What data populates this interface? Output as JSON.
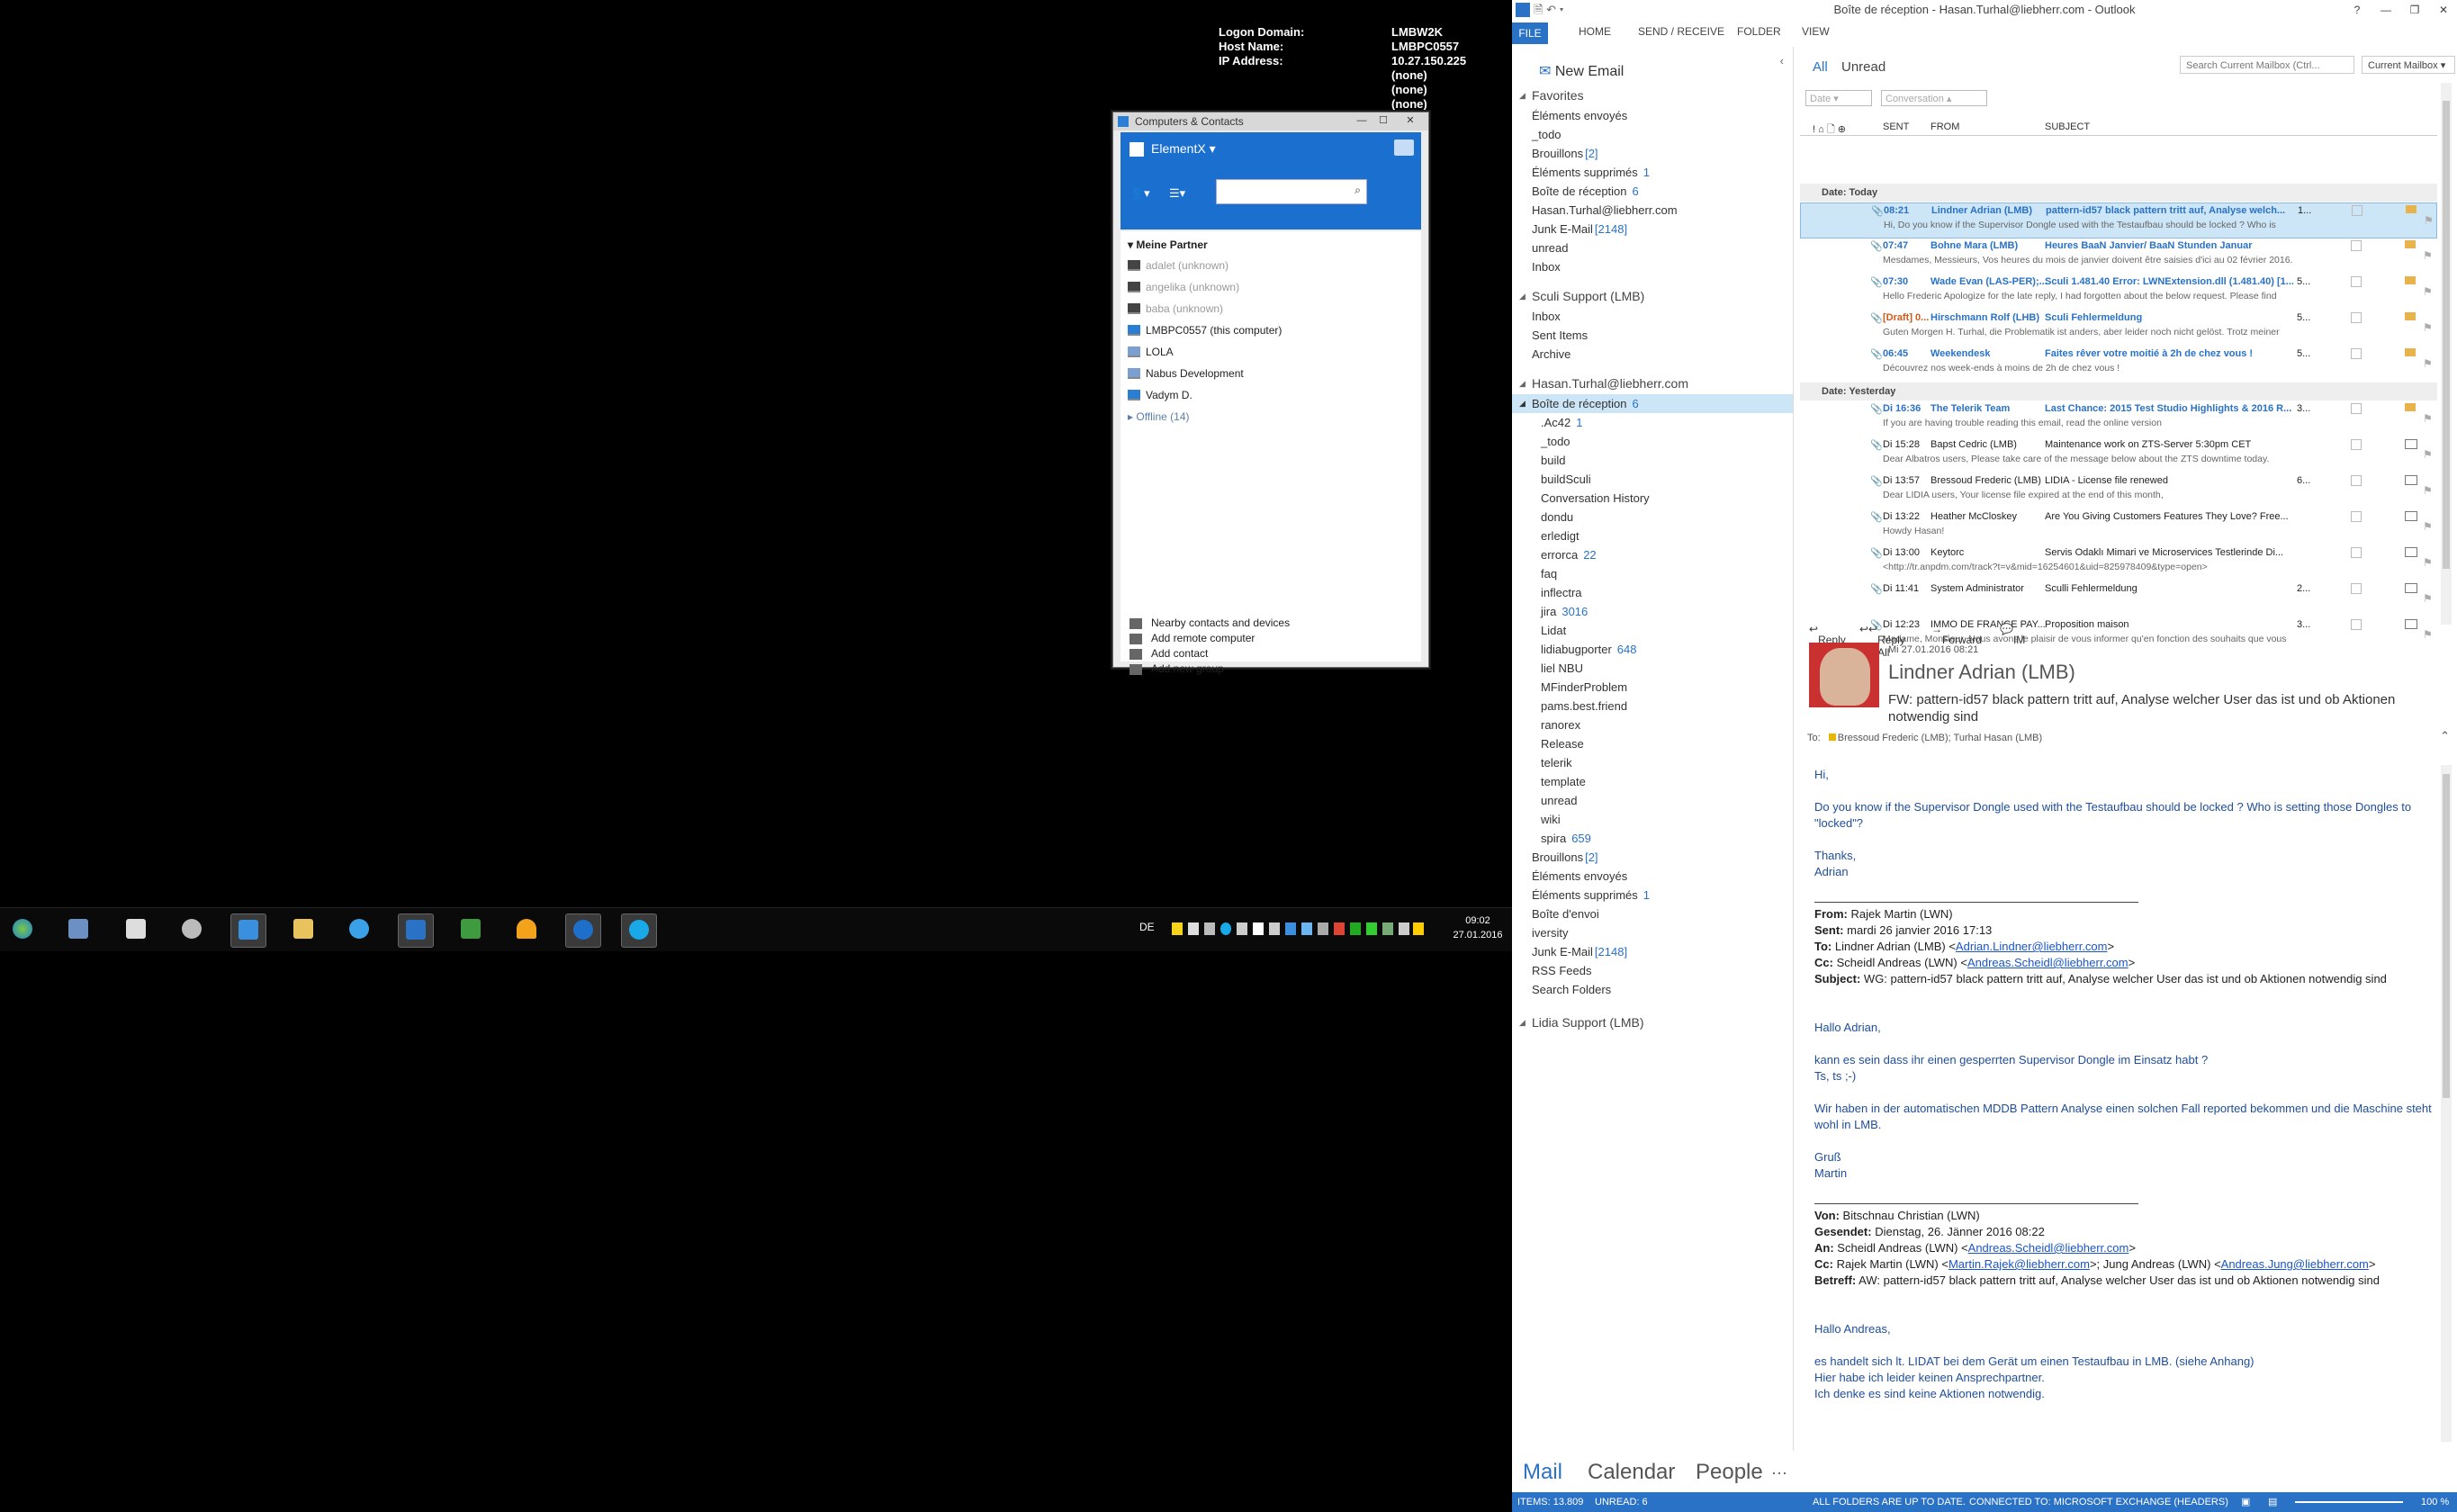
{
  "bginfo": {
    "rows": [
      {
        "k": "Logon Domain:",
        "v": "LMBW2K"
      },
      {
        "k": "Host Name:",
        "v": "LMBPC0557"
      },
      {
        "k": "IP Address:",
        "v": "10.27.150.225"
      },
      {
        "k": "",
        "v": "(none)"
      },
      {
        "k": "",
        "v": "(none)"
      },
      {
        "k": "",
        "v": "(none)"
      },
      {
        "k": "",
        "v": "(none)"
      }
    ]
  },
  "teamviewer": {
    "title": "Computers & Contacts",
    "account": "ElementX ▾",
    "search_placeholder": "",
    "group": "Meine Partner",
    "items": [
      {
        "label": "adalet (unknown)",
        "offline": true
      },
      {
        "label": "angelika (unknown)",
        "offline": true
      },
      {
        "label": "baba (unknown)",
        "offline": true
      },
      {
        "label": "LMBPC0557 (this computer)",
        "offline": false
      },
      {
        "label": "LOLA",
        "offline": false
      },
      {
        "label": "Nabus Development",
        "offline": false
      },
      {
        "label": "Vadym D.",
        "offline": false
      }
    ],
    "offline_group": "Offline (14)",
    "actions": [
      "Nearby contacts and devices",
      "Add remote computer",
      "Add contact",
      "Add new group"
    ]
  },
  "taskbar": {
    "lang": "DE",
    "time": "09:02",
    "date": "27.01.2016"
  },
  "outlook": {
    "window_title": "Boîte de réception - Hasan.Turhal@liebherr.com - Outlook",
    "ribbon": [
      "FILE",
      "HOME",
      "SEND / RECEIVE",
      "FOLDER",
      "VIEW"
    ],
    "new_email": "New Email",
    "favorites": {
      "title": "Favorites",
      "items": [
        {
          "label": "Éléments envoyés",
          "count": ""
        },
        {
          "label": "_todo",
          "count": ""
        },
        {
          "label": "Brouillons",
          "count": "[2]"
        },
        {
          "label": "Éléments supprimés",
          "count": "1"
        },
        {
          "label": "Boîte de réception",
          "count": "6"
        },
        {
          "label": "Hasan.Turhal@liebherr.com",
          "count": ""
        },
        {
          "label": "Junk E-Mail",
          "count": "[2148]"
        },
        {
          "label": "unread",
          "count": ""
        },
        {
          "label": "Inbox",
          "count": ""
        }
      ]
    },
    "sculi": {
      "title": "Sculi Support (LMB)",
      "items": [
        "Inbox",
        "Sent Items",
        "Archive"
      ]
    },
    "account": {
      "title": "Hasan.Turhal@liebherr.com",
      "inbox": {
        "label": "Boîte de réception",
        "count": "6"
      },
      "sub": [
        {
          "label": ".Ac42",
          "count": "1"
        },
        {
          "label": "_todo",
          "count": ""
        },
        {
          "label": "build",
          "count": ""
        },
        {
          "label": "buildSculi",
          "count": ""
        },
        {
          "label": "Conversation History",
          "count": ""
        },
        {
          "label": "dondu",
          "count": ""
        },
        {
          "label": "erledigt",
          "count": ""
        },
        {
          "label": "errorca",
          "count": "22"
        },
        {
          "label": "faq",
          "count": ""
        },
        {
          "label": "inflectra",
          "count": ""
        },
        {
          "label": "jira",
          "count": "3016"
        },
        {
          "label": "Lidat",
          "count": ""
        },
        {
          "label": "lidiabugporter",
          "count": "648"
        },
        {
          "label": "liel NBU",
          "count": ""
        },
        {
          "label": "MFinderProblem",
          "count": ""
        },
        {
          "label": "pams.best.friend",
          "count": ""
        },
        {
          "label": "ranorex",
          "count": ""
        },
        {
          "label": "Release",
          "count": ""
        },
        {
          "label": "telerik",
          "count": ""
        },
        {
          "label": "template",
          "count": ""
        },
        {
          "label": "unread",
          "count": ""
        },
        {
          "label": "wiki",
          "count": ""
        },
        {
          "label": "spira",
          "count": "659"
        }
      ],
      "rest": [
        {
          "label": "Brouillons",
          "count": "[2]"
        },
        {
          "label": "Éléments envoyés",
          "count": ""
        },
        {
          "label": "Éléments supprimés",
          "count": "1"
        },
        {
          "label": "Boîte d'envoi",
          "count": ""
        },
        {
          "label": "iversity",
          "count": ""
        },
        {
          "label": "Junk E-Mail",
          "count": "[2148]"
        },
        {
          "label": "RSS Feeds",
          "count": ""
        },
        {
          "label": "Search Folders",
          "count": ""
        }
      ]
    },
    "lidia": "Lidia Support (LMB)",
    "bottomnav": [
      "Mail",
      "Calendar",
      "People",
      "···"
    ],
    "status": {
      "items": "ITEMS: 13.809",
      "unread": "UNREAD: 6",
      "sync": "ALL FOLDERS ARE UP TO DATE.",
      "conn": "CONNECTED TO: MICROSOFT EXCHANGE (HEADERS)",
      "zoom": "100 %"
    },
    "list": {
      "filter_all": "All",
      "filter_unread": "Unread",
      "search_placeholder": "Search Current Mailbox (Ctrl...",
      "scope": "Current Mailbox ▾",
      "sort_date": "Date",
      "sort_conv": "Conversation",
      "headers": {
        "sent": "SENT",
        "from": "FROM",
        "subject": "SUBJECT"
      },
      "today": "Date: Today",
      "yesterday": "Date: Yesterday",
      "today_msgs": [
        {
          "time": "08:21",
          "from": "Lindner Adrian (LMB)",
          "subject": "pattern-id57 black pattern tritt auf, Analyse welch...",
          "preview": "Hi,  Do you know if the Supervisor Dongle used with the Testaufbau should be locked ? Who is",
          "size": "1...",
          "unread": true,
          "sel": true
        },
        {
          "time": "07:47",
          "from": "Bohne Mara (LMB)",
          "subject": "Heures BaaN Janvier/ BaaN Stunden Januar",
          "preview": "Mesdames, Messieurs,  Vos heures du mois de janvier doivent être saisies d'ici au 02 février 2016.",
          "size": "",
          "unread": true,
          "sel": false
        },
        {
          "time": "07:30",
          "from": "Wade Evan (LAS-PER);...",
          "subject": "Sculi 1.481.40 Error: LWNExtension.dll (1.481.40) [1...",
          "preview": "Hello Frederic  Apologize for the late reply, I had forgotten about the below request.  Please find",
          "size": "5...",
          "unread": true,
          "sel": false
        },
        {
          "time": "[Draft] 0...",
          "from": "Hirschmann Rolf (LHB)",
          "subject": "Sculi Fehlermeldung",
          "preview": "Guten Morgen H. Turhal,  die Problematik ist anders, aber leider noch nicht gelöst. Trotz meiner",
          "size": "5...",
          "unread": true,
          "sel": false
        },
        {
          "time": "06:45",
          "from": "Weekendesk",
          "subject": "Faites rêver votre moitié à 2h de chez vous !",
          "preview": "Découvrez nos week-ends à moins de 2h de chez vous !",
          "size": "5...",
          "unread": true,
          "sel": false
        }
      ],
      "yest_msgs": [
        {
          "time": "Di 16:36",
          "from": "The Telerik Team",
          "subject": "Last Chance: 2015 Test Studio Highlights & 2016 R...",
          "preview": "If you are having trouble reading this email, read the online version",
          "size": "3...",
          "unread": true
        },
        {
          "time": "Di 15:28",
          "from": "Bapst Cedric (LMB)",
          "subject": "Maintenance work on ZTS-Server 5:30pm CET",
          "preview": "Dear Albatros users,  Please take care of the message below about the ZTS downtime today.",
          "size": "",
          "unread": false
        },
        {
          "time": "Di 13:57",
          "from": "Bressoud Frederic (LMB)",
          "subject": "LIDIA - License file renewed",
          "preview": "Dear LIDIA users,  Your license file expired at the end of this month,",
          "size": "6...",
          "unread": false
        },
        {
          "time": "Di 13:22",
          "from": "Heather McCloskey",
          "subject": "Are You Giving Customers Features They Love? Free...",
          "preview": "Howdy Hasan!",
          "size": "",
          "unread": false
        },
        {
          "time": "Di 13:00",
          "from": "Keytorc",
          "subject": "Servis Odaklı Mimari ve Microservices Testlerinde Di...",
          "preview": "<http://tr.anpdm.com/track?t=v&mid=16254601&uid=825978409&type=open>",
          "size": "",
          "unread": false
        },
        {
          "time": "Di 11:41",
          "from": "System Administrator",
          "subject": "Sculli Fehlermeldung",
          "preview": "",
          "size": "2...",
          "unread": false
        },
        {
          "time": "Di 12:23",
          "from": "IMMO DE FRANCE PAY...",
          "subject": "Proposition maison",
          "preview": "Madame, Monsieur,  Nous avons le plaisir de vous informer qu'en fonction des souhaits que vous",
          "size": "3...",
          "unread": false
        }
      ]
    },
    "reading": {
      "actions": [
        "Reply",
        "Reply All",
        "Forward",
        "IM"
      ],
      "date": "Mi 27.01.2016 08:21",
      "from": "Lindner Adrian (LMB)",
      "subject": "FW: pattern-id57 black pattern tritt auf, Analyse welcher User das ist und ob Aktionen notwendig sind",
      "to_label": "To:",
      "to": "Bressoud Frederic (LMB);  Turhal Hasan (LMB)",
      "body": {
        "hi": "Hi,",
        "q1": "Do you know if the Supervisor Dongle used with the Testaufbau should be locked ? Who is setting those Dongles to \"locked\"?",
        "thanks": "Thanks,",
        "adrian": "Adrian",
        "from_k": "From:",
        "from_v": "Rajek Martin (LWN)",
        "sent_k": "Sent:",
        "sent_v": "mardi 26 janvier 2016 17:13",
        "to_k": "To:",
        "to_v": "Lindner Adrian (LMB) <",
        "to_link": "Adrian.Lindner@liebherr.com",
        "to_end": ">",
        "cc_k": "Cc:",
        "cc_v": "Scheidl Andreas (LWN) <",
        "cc_link": "Andreas.Scheidl@liebherr.com",
        "cc_end": ">",
        "subj_k": "Subject:",
        "subj_v": "WG: pattern-id57 black pattern tritt auf, Analyse welcher User das ist und ob Aktionen notwendig sind",
        "hallo_a": "Hallo Adrian,",
        "kann": "kann es sein dass ihr einen gesperrten Supervisor Dongle im Einsatz habt ?",
        "ts": "Ts, ts ;-)",
        "wir": "Wir haben in der automatischen MDDB Pattern Analyse einen solchen Fall reported bekommen und die Maschine steht wohl in LMB.",
        "gruss": "Gruß",
        "martin": "Martin",
        "von_k": "Von:",
        "von_v": "Bitschnau Christian (LWN)",
        "ges_k": "Gesendet:",
        "ges_v": "Dienstag, 26. Jänner 2016 08:22",
        "an_k": "An:",
        "an_v": "Scheidl Andreas (LWN) <",
        "an_link": "Andreas.Scheidl@liebherr.com",
        "an_end": ">",
        "cc2_k": "Cc:",
        "cc2_v": "Rajek Martin (LWN) <",
        "cc2_link": "Martin.Rajek@liebherr.com",
        "cc2_mid": ">; Jung Andreas (LWN) <",
        "cc2_link2": "Andreas.Jung@liebherr.com",
        "cc2_end": ">",
        "bet_k": "Betreff:",
        "bet_v": "AW: pattern-id57 black pattern tritt auf, Analyse welcher User das ist und ob Aktionen notwendig sind",
        "hallo_and": "Hallo Andreas,",
        "es": "es handelt sich lt. LIDAT bei dem Gerät um einen Testaufbau in LMB. (siehe Anhang)",
        "hier": "Hier habe ich leider keinen Ansprechpartner.",
        "ich": "Ich denke es sind keine Aktionen notwendig."
      }
    }
  }
}
